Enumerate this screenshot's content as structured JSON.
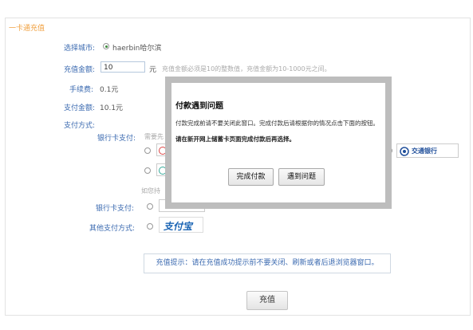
{
  "panel": {
    "title": "一卡通充值"
  },
  "city": {
    "label": "选择城市:",
    "value": "haerbin哈尔滨"
  },
  "amount": {
    "label": "充值金额:",
    "value": "10",
    "unit": "元",
    "hint": "充值金额必须是10的整数值，充值金额为10-1000元之间。"
  },
  "fee": {
    "label": "手续费:",
    "value": "0.1元"
  },
  "pay_amount": {
    "label": "支付金额:",
    "value": "10.1元"
  },
  "payment": {
    "label": "支付方式:",
    "bank_card_label": "银行卡支付:",
    "bank_card_hint": "需要先",
    "more_hint": "如您持",
    "bank_card_label2": "银行卡支付:",
    "other_label": "其他支付方式:",
    "alipay_text": "支付宝",
    "bocom_text": "交通银行"
  },
  "notice": {
    "text": "充值提示：请在充值成功提示前不要关闭、刷新或者后退浏览器窗口。"
  },
  "submit": {
    "label": "充值"
  },
  "modal": {
    "title": "付款遇到问题",
    "message": "付款完成前请不要关闭此窗口。完成付款后请根据你的情况点击下面的按钮。",
    "bold_message": "请在新开网上储蓄卡页面完成付款后再选择。",
    "done_button": "完成付款",
    "problem_button": "遇到问题"
  },
  "colors": {
    "accent_orange": "#f0a040",
    "label_blue": "#3b6ab0",
    "alipay_blue": "#1a64b4",
    "bocom_blue": "#1f4e9a"
  }
}
